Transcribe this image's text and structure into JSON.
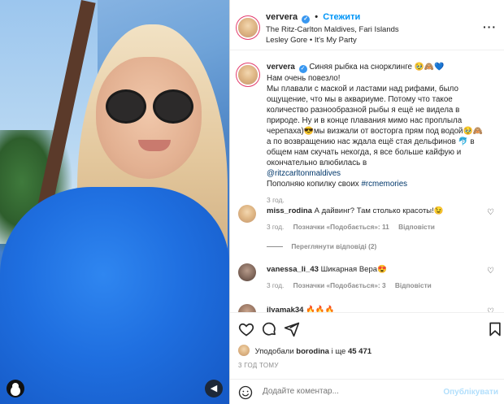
{
  "post": {
    "username": "ververa",
    "follow_label": "Стежити",
    "location": "The Ritz-Carlton Maldives, Fari Islands",
    "music": "Lesley Gore • It's My Party",
    "caption": {
      "username": "ververa",
      "text_1": "Синяя рыбка на снорклинге 🥹🙈💙",
      "text_2": "Нам очень повезло!",
      "text_3": "Мы плавали с маской и ластами над рифами, было ощущение, что мы в аквариуме. Потому что такое количество разнообразной рыбы я ещё не видела в природе. Ну и в конце плавания мимо нас проплыла черепаха)😎мы визжали от восторга прям под водой🥹🙈 а по возвращению нас ждала ещё стая дельфинов 🐬 в общем нам скучать некогда, я все больше кайфую и окончательно влюбилась в",
      "mention": "@ritzcarltonmaldives",
      "text_4": "Пополняю копилку своих",
      "hashtag": "#rcmemories",
      "time": "3 год."
    },
    "comments": [
      {
        "username": "miss_rodina",
        "text": "А дайвинг? Там столько красоты!😉",
        "time": "3 год.",
        "likes": "Позначки «Подобається»: 11",
        "reply": "Відповісти",
        "view_replies": "Переглянути відповіді (2)"
      },
      {
        "username": "vanessa_li_43",
        "text": "Шикарная Вера😍",
        "time": "3 год.",
        "likes": "Позначки «Подобається»: 3",
        "reply": "Відповісти"
      },
      {
        "username": "ilyamak34",
        "text": "🔥🔥🔥"
      }
    ],
    "liked_by_prefix": "Уподобали",
    "liked_by_user": "borodina",
    "liked_by_suffix": "і ще",
    "liked_count": "45 471",
    "post_time": "3 ГОД ТОМУ",
    "composer_placeholder": "Додайте коментар...",
    "publish_label": "Опублікувати"
  },
  "colors": {
    "link": "#00376b",
    "follow": "#0095f6",
    "verified": "#3897f0",
    "muted": "#8e8e8e"
  },
  "icons": [
    "heart-icon",
    "comment-icon",
    "share-icon",
    "bookmark-icon",
    "emoji-icon",
    "more-icon",
    "mute-icon",
    "user-tag-icon"
  ]
}
